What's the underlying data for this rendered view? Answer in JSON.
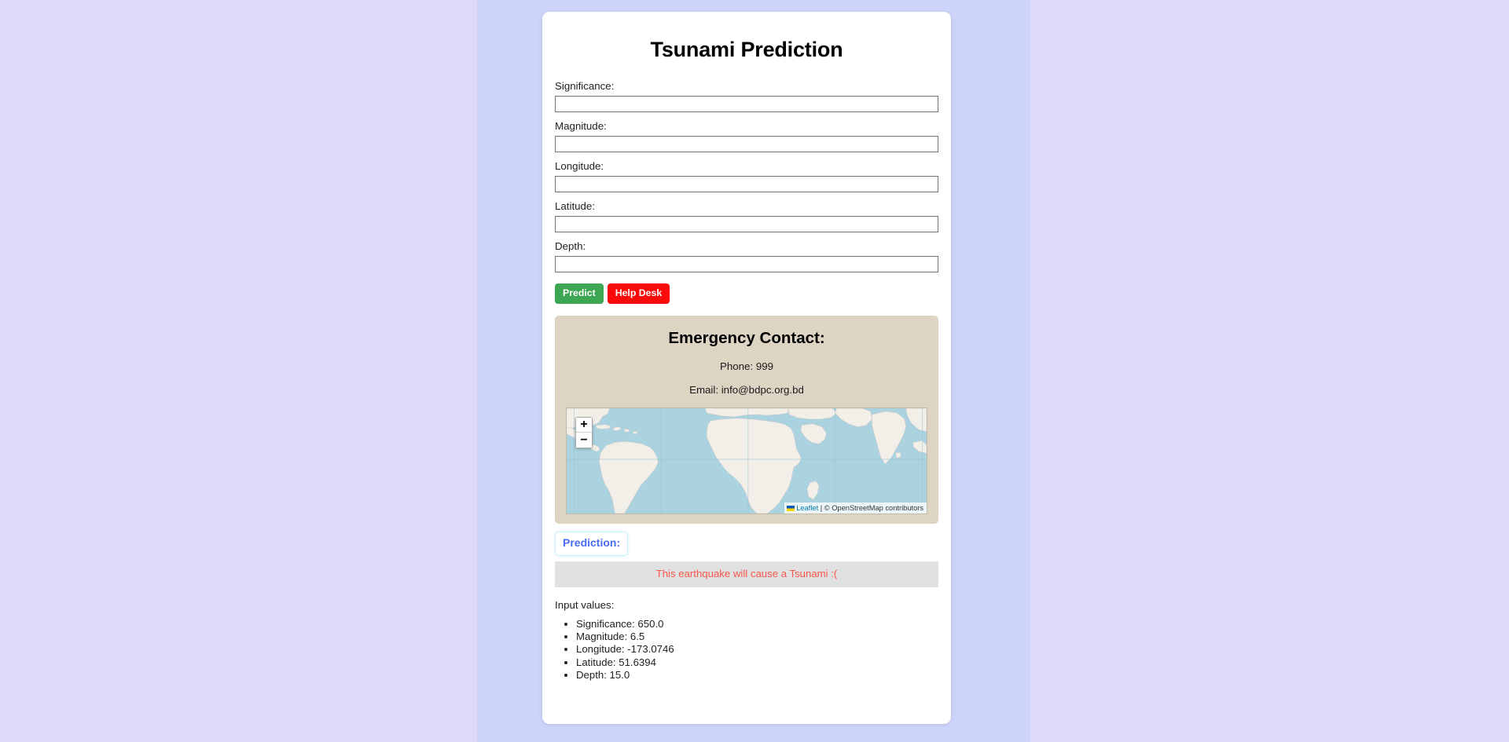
{
  "page": {
    "title": "Tsunami Prediction",
    "background_outer": "#ded9f7",
    "background_band": "#ccd4f9",
    "card_background": "#ffffff"
  },
  "form": {
    "fields": [
      {
        "label": "Significance:",
        "value": "",
        "placeholder": ""
      },
      {
        "label": "Magnitude:",
        "value": "",
        "placeholder": ""
      },
      {
        "label": "Longitude:",
        "value": "",
        "placeholder": ""
      },
      {
        "label": "Latitude:",
        "value": "",
        "placeholder": ""
      },
      {
        "label": "Depth:",
        "value": "",
        "placeholder": ""
      }
    ],
    "buttons": {
      "predict_label": "Predict",
      "predict_color": "#3ca653",
      "help_label": "Help Desk",
      "help_color": "#fa0a0a"
    }
  },
  "emergency": {
    "heading": "Emergency Contact:",
    "phone_line": "Phone: 999",
    "email_line": "Email: info@bdpc.org.bd",
    "panel_color": "#ddd4c4"
  },
  "map": {
    "zoom_in_label": "+",
    "zoom_out_label": "−",
    "zoom_in_icon": "plus-icon",
    "zoom_out_icon": "minus-icon",
    "attribution_library": "Leaflet",
    "attribution_separator": " | ",
    "attribution_source": "© OpenStreetMap contributors",
    "water_color": "#aad3df",
    "land_color": "#f2efe9"
  },
  "prediction": {
    "label": "Prediction:",
    "label_color": "#4a6bf5",
    "result_text": "This earthquake will cause a Tsunami :(",
    "result_color": "#f9564a",
    "result_background": "#e1e1e1"
  },
  "input_values": {
    "heading": "Input values:",
    "items": [
      "Significance: 650.0",
      "Magnitude: 6.5",
      "Longitude: -173.0746",
      "Latitude: 51.6394",
      "Depth: 15.0"
    ]
  }
}
